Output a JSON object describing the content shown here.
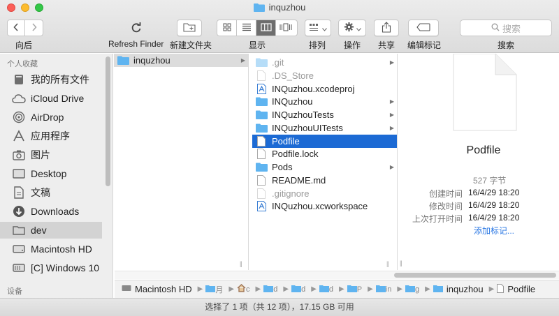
{
  "window": {
    "title": "inquzhou"
  },
  "colors": {
    "accent": "#1c6ad4",
    "folder": "#5fb4f0",
    "link": "#2b78e4"
  },
  "toolbar": {
    "back_label": "向后",
    "refresh_label": "Refresh Finder",
    "new_folder_label": "新建文件夹",
    "view_label": "显示",
    "sort_label": "排列",
    "action_label": "操作",
    "share_label": "共享",
    "tags_label": "编辑标记",
    "search_label": "搜索",
    "search_placeholder": "搜索"
  },
  "sidebar": {
    "favorites_header": "个人收藏",
    "devices_header": "设备",
    "items": [
      {
        "label": "我的所有文件",
        "icon": "all-files-icon"
      },
      {
        "label": "iCloud Drive",
        "icon": "cloud-icon"
      },
      {
        "label": "AirDrop",
        "icon": "airdrop-icon"
      },
      {
        "label": "应用程序",
        "icon": "applications-icon"
      },
      {
        "label": "图片",
        "icon": "camera-icon"
      },
      {
        "label": "Desktop",
        "icon": "desktop-icon"
      },
      {
        "label": "文稿",
        "icon": "documents-icon"
      },
      {
        "label": "Downloads",
        "icon": "download-icon"
      },
      {
        "label": "dev",
        "icon": "folder-icon",
        "selected": true
      },
      {
        "label": "Macintosh HD",
        "icon": "disk-icon"
      },
      {
        "label": "[C] Windows 10",
        "icon": "windows-disk-icon"
      }
    ]
  },
  "column1": {
    "items": [
      {
        "label": "inquzhou",
        "type": "folder",
        "has_children": true
      }
    ]
  },
  "column2": {
    "items": [
      {
        "label": ".git",
        "type": "folder",
        "dim": true,
        "has_children": true
      },
      {
        "label": ".DS_Store",
        "type": "file",
        "dim": true,
        "has_children": false
      },
      {
        "label": "INQuzhou.xcodeproj",
        "type": "xcode",
        "dim": false,
        "has_children": false
      },
      {
        "label": "INQuzhou",
        "type": "folder",
        "dim": false,
        "has_children": true
      },
      {
        "label": "INQuzhouTests",
        "type": "folder",
        "dim": false,
        "has_children": true
      },
      {
        "label": "INQuzhouUITests",
        "type": "folder",
        "dim": false,
        "has_children": true
      },
      {
        "label": "Podfile",
        "type": "file",
        "dim": false,
        "has_children": false,
        "selected": true
      },
      {
        "label": "Podfile.lock",
        "type": "file",
        "dim": false,
        "has_children": false
      },
      {
        "label": "Pods",
        "type": "folder",
        "dim": false,
        "has_children": true
      },
      {
        "label": "README.md",
        "type": "file",
        "dim": false,
        "has_children": false
      },
      {
        "label": ".gitignore",
        "type": "file",
        "dim": true,
        "has_children": false
      },
      {
        "label": "INQuzhou.xcworkspace",
        "type": "xcode",
        "dim": false,
        "has_children": false
      }
    ]
  },
  "preview": {
    "name": "Podfile",
    "size": "527 字节",
    "created_key": "创建时间",
    "created_val": "16/4/29 18:20",
    "modified_key": "修改时间",
    "modified_val": "16/4/29 18:20",
    "opened_key": "上次打开时间",
    "opened_val": "16/4/29 18:20",
    "add_tags": "添加标记..."
  },
  "pathbar": {
    "start": "Macintosh HD",
    "folder": "inquzhou",
    "file": "Podfile",
    "truncated": [
      "月",
      "c",
      "d",
      "d",
      "d",
      "P",
      "in",
      "g"
    ]
  },
  "status": {
    "text": "选择了 1 项（共 12 项），17.15 GB 可用"
  }
}
